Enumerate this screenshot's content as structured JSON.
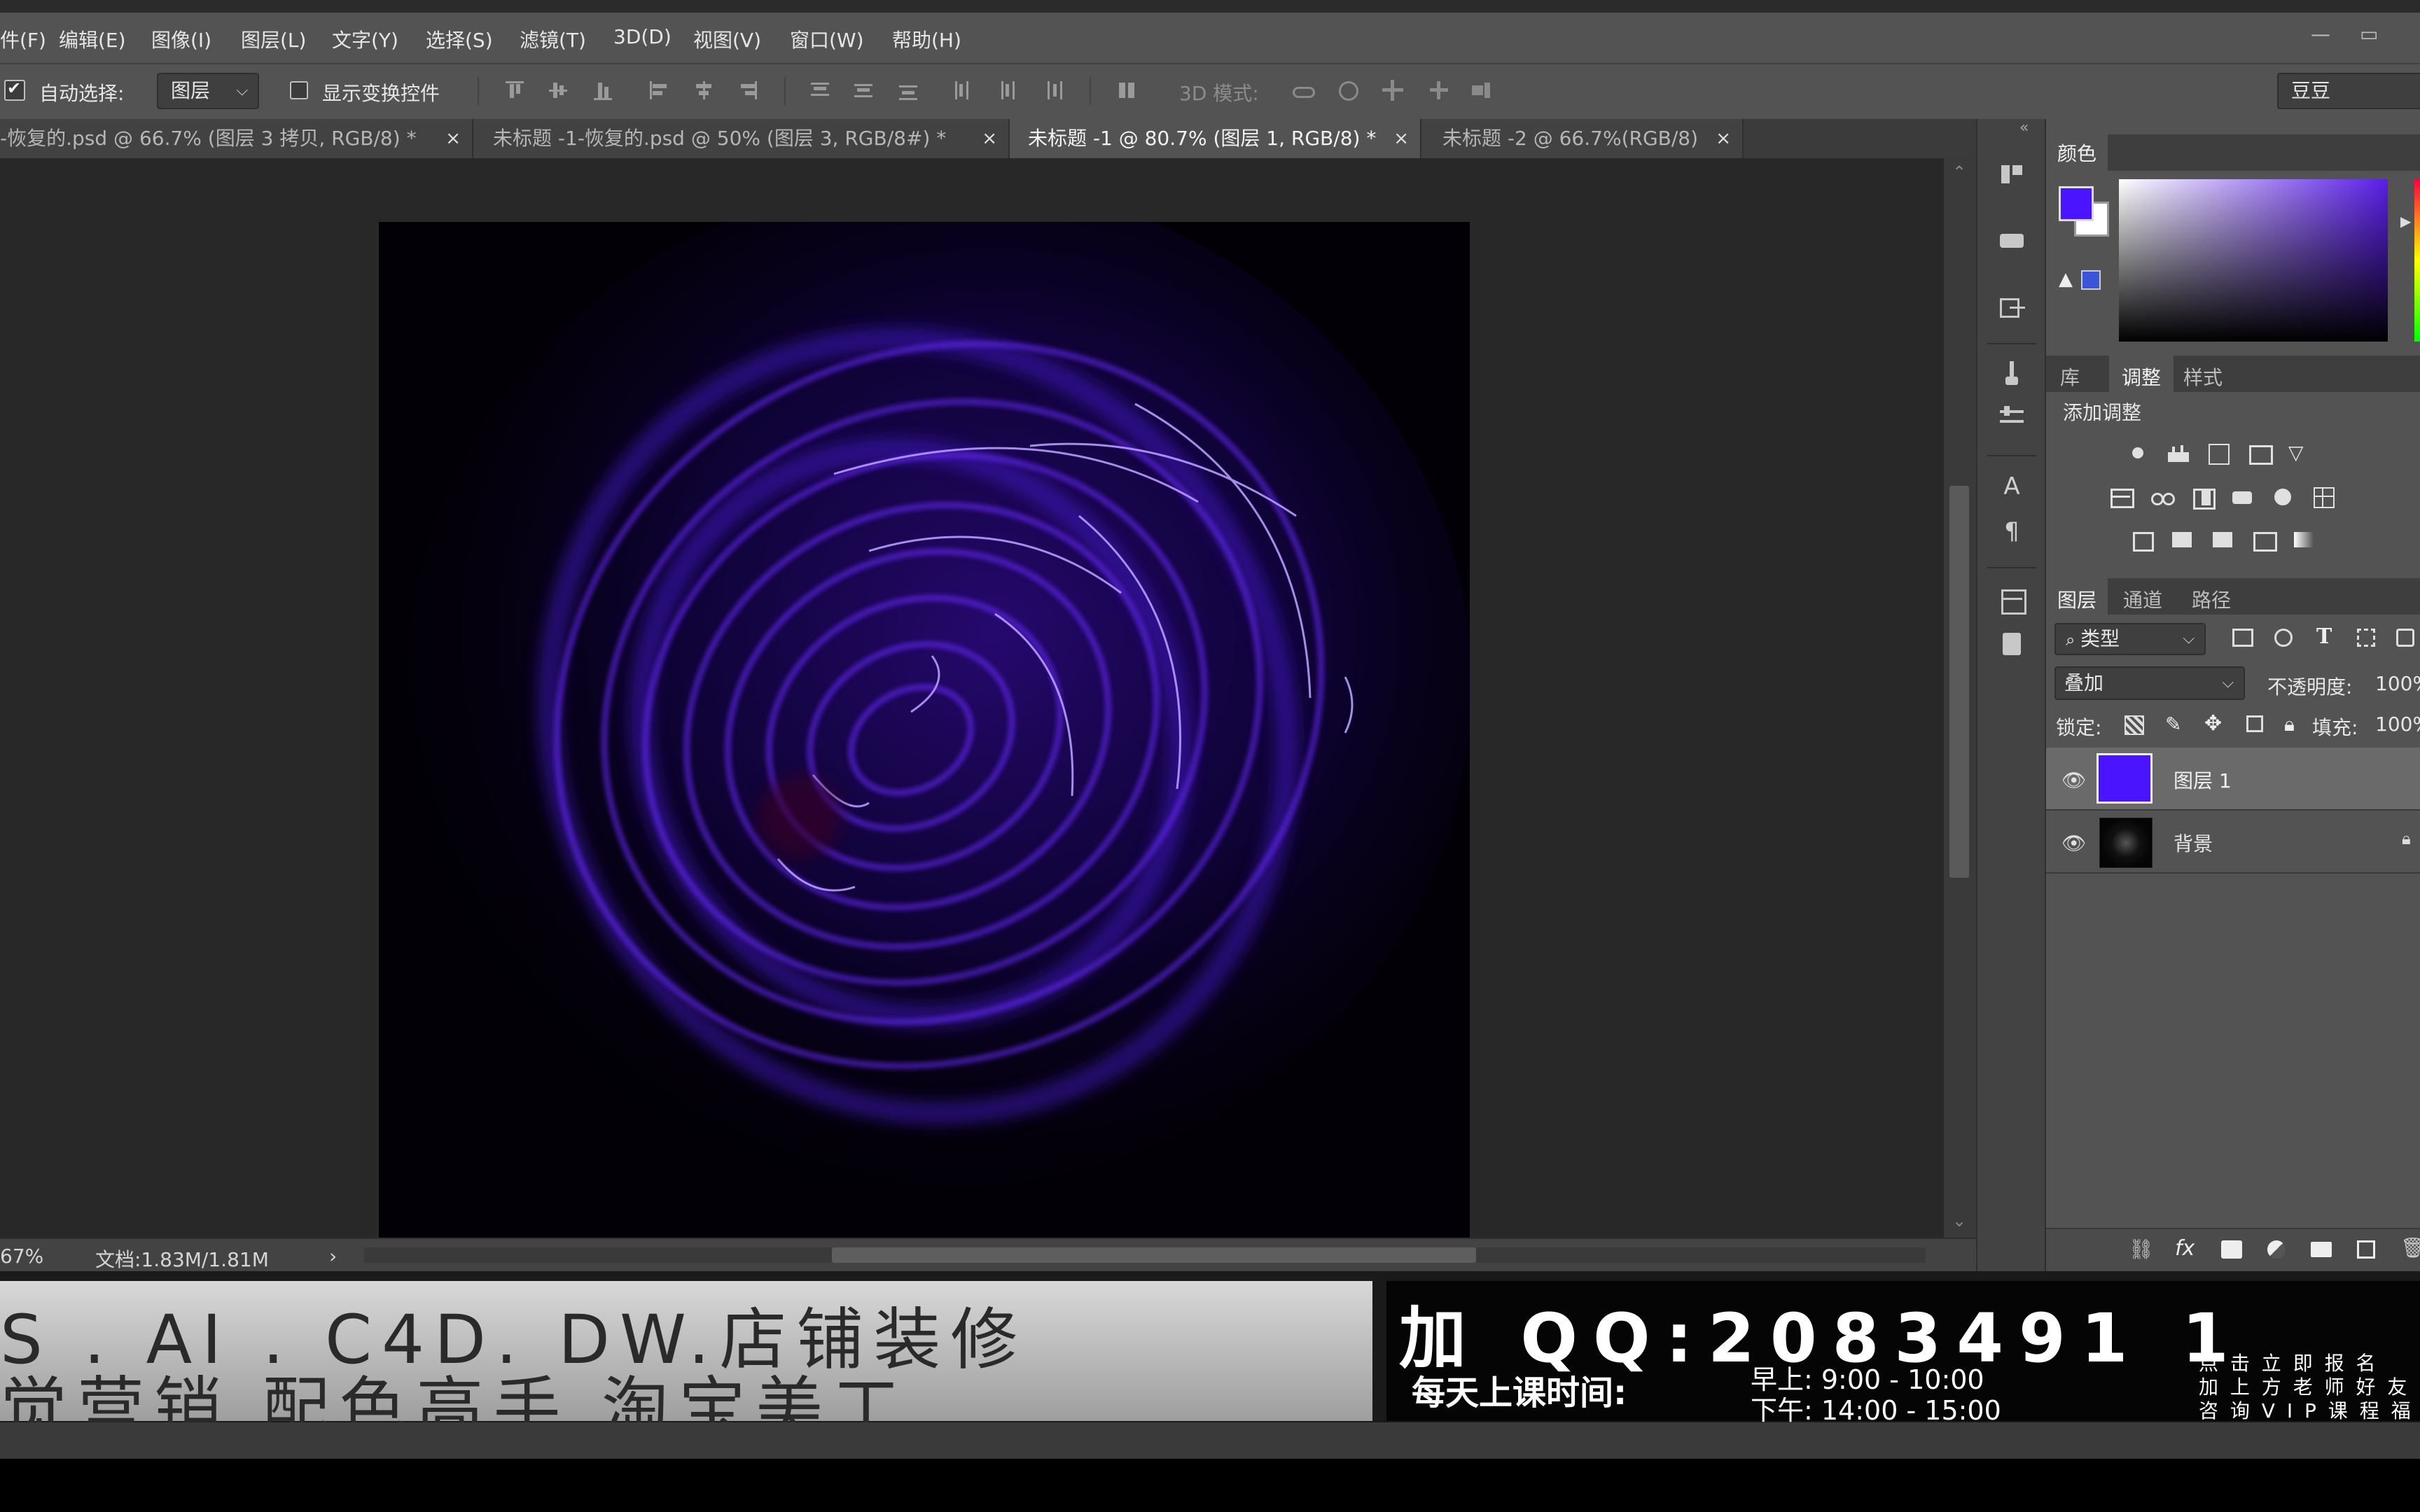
{
  "menu": {
    "items": [
      "件(F)",
      "编辑(E)",
      "图像(I)",
      "图层(L)",
      "文字(Y)",
      "选择(S)",
      "滤镜(T)",
      "3D(D)",
      "视图(V)",
      "窗口(W)",
      "帮助(H)"
    ]
  },
  "window_controls": {
    "minimize": "—",
    "restore": "▭"
  },
  "options": {
    "auto_select_label": "自动选择:",
    "auto_select_checked": true,
    "auto_select_target": "图层",
    "show_transform_label": "显示变换控件",
    "show_transform_checked": false,
    "mode_3d_label": "3D 模式:",
    "workspace_name": "豆豆"
  },
  "tabs": [
    {
      "label": "-恢复的.psd @ 66.7% (图层 3 拷贝, RGB/8) *",
      "close": "×",
      "active": false
    },
    {
      "label": "未标题 -1-恢复的.psd @ 50% (图层 3, RGB/8#) *",
      "close": "×",
      "active": false
    },
    {
      "label": "未标题 -1 @ 80.7% (图层 1, RGB/8) *",
      "close": "×",
      "active": true
    },
    {
      "label": "未标题 -2 @ 66.7%(RGB/8)",
      "close": "×",
      "active": false
    }
  ],
  "status": {
    "zoom": "67%",
    "doc_size": "文档:1.83M/1.81M",
    "arrow": "›"
  },
  "color_panel": {
    "title": "颜色",
    "foreground": "#4a14ff",
    "background": "#ffffff",
    "field_hue": "#5a1ee8"
  },
  "adjust_panel": {
    "tabs": [
      "库",
      "调整",
      "样式"
    ],
    "active_tab": "调整",
    "heading": "添加调整"
  },
  "layers_panel": {
    "tabs": [
      "图层",
      "通道",
      "路径"
    ],
    "active_tab": "图层",
    "filter_kind": "类型",
    "blend_mode": "叠加",
    "opacity_label": "不透明度:",
    "opacity_value": "100%",
    "lock_label": "锁定:",
    "fill_label": "填充:",
    "fill_value": "100%",
    "layers": [
      {
        "name": "图层 1",
        "visible": true,
        "selected": true,
        "thumb_color": "#4a14ff"
      },
      {
        "name": "背景",
        "visible": true,
        "selected": false,
        "locked": true,
        "thumb_color": "#0a0a0a"
      }
    ]
  },
  "banner": {
    "left_line1": "S . AI . C4D. DW.店铺装修",
    "left_line2": "觉营销  配色高手  淘宝美工",
    "right_qq": "加 QQ:2083491 1",
    "schedule_label": "每天上课时间:",
    "schedule_morning": "早上: 9:00 - 10:00",
    "schedule_afternoon": "下午: 14:00 - 15:00",
    "side_line1": "点 击 立 即 报 名",
    "side_line2": "加 上 方 老 师 好 友",
    "side_line3": "咨 询 V I P 课 程 福"
  }
}
